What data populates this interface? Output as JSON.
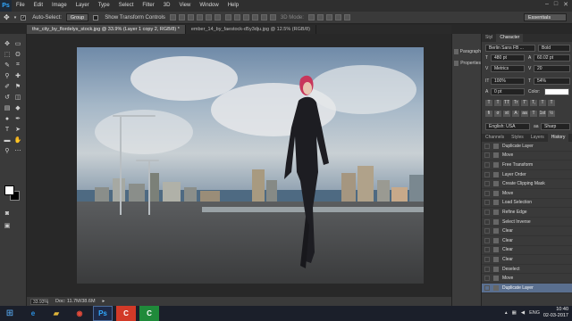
{
  "app": {
    "logo": "Ps"
  },
  "menu": [
    "File",
    "Edit",
    "Image",
    "Layer",
    "Type",
    "Select",
    "Filter",
    "3D",
    "View",
    "Window",
    "Help"
  ],
  "options": {
    "auto_select_label": "Auto-Select:",
    "auto_select_value": "Group",
    "show_transform_label": "Show Transform Controls",
    "mode_3d": "3D Mode:",
    "workspace": "Essentials"
  },
  "doc_tabs": [
    "the_city_by_flordelys_stock.jpg @ 33.9% (Layer 1 copy 2, RGB/8) *",
    "ember_14_by_faestock-d5y3dju.jpg @ 12.5% (RGB/8)"
  ],
  "status": {
    "zoom": "33.93%",
    "doc": "Doc: 11.7M/38.6M"
  },
  "dock": [
    {
      "icon": "paragraph-icon",
      "label": "Paragraph"
    },
    {
      "icon": "properties-icon",
      "label": "Properties"
    }
  ],
  "character_panel": {
    "tabs": [
      "Styl",
      "Character"
    ],
    "font_family": "Berlin Sans FB ...",
    "font_style": "Bold",
    "size": "480 pt",
    "leading": "60.02 pt",
    "kerning": "Metrics",
    "tracking": "20",
    "vscale": "100%",
    "hscale": "54%",
    "baseline": "0 pt",
    "color_label": "Color:",
    "language": "English: USA",
    "aa_label": "aa",
    "antialias": "Sharp",
    "tt_row1": [
      "T",
      "T",
      "TT",
      "Tr",
      "T'",
      "T,",
      "T",
      "T"
    ],
    "tt_row2": [
      "fi",
      "σ",
      "st",
      "A",
      "aa",
      "T",
      "1st",
      "½"
    ]
  },
  "history_panel": {
    "tabs": [
      "Channels",
      "Styles",
      "Layers",
      "History"
    ],
    "items": [
      "Duplicate Layer",
      "Move",
      "Free Transform",
      "Layer Order",
      "Create Clipping Mask",
      "Move",
      "Load Selection",
      "Refine Edge",
      "Select Inverse",
      "Clear",
      "Clear",
      "Clear",
      "Clear",
      "Deselect",
      "Move",
      "Duplicate Layer"
    ],
    "active_index": 15
  },
  "taskbar": {
    "lang": "ENG",
    "time": "10:40",
    "date": "02-03-2017"
  }
}
